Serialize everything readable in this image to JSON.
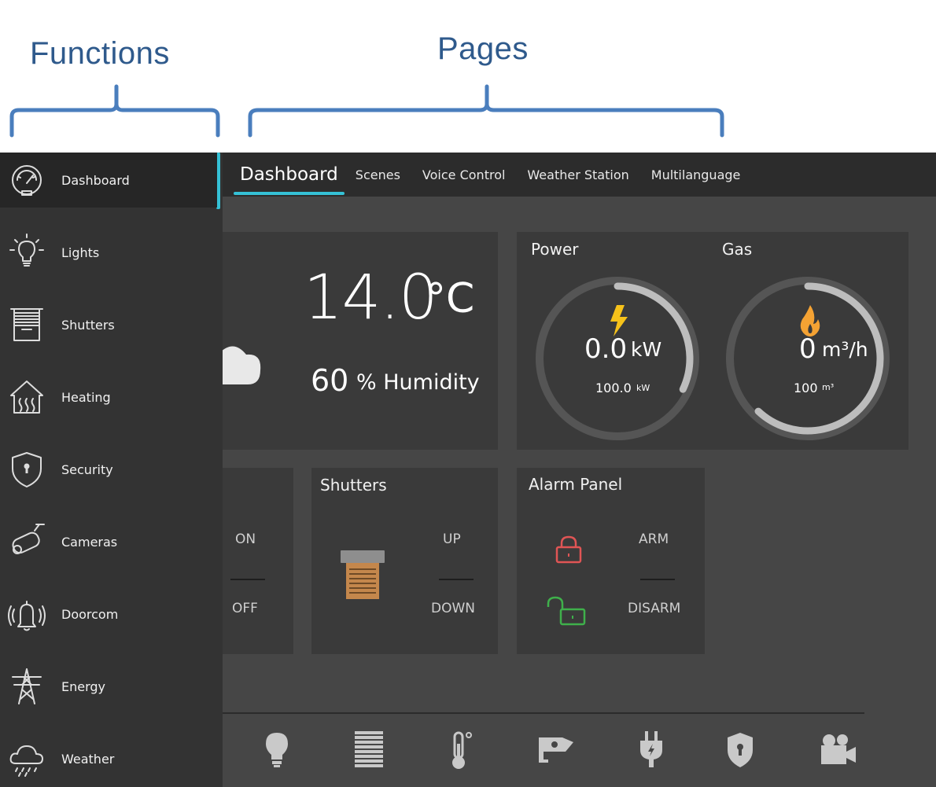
{
  "annotations": {
    "functions": "Functions",
    "pages": "Pages"
  },
  "tabs": [
    {
      "label": "Dashboard",
      "active": true
    },
    {
      "label": "Scenes"
    },
    {
      "label": "Voice Control"
    },
    {
      "label": "Weather Station"
    },
    {
      "label": "Multilanguage"
    }
  ],
  "sidebar": {
    "items": [
      {
        "label": "Dashboard",
        "icon": "gauge-icon",
        "active": true
      },
      {
        "label": "Lights",
        "icon": "bulb-icon"
      },
      {
        "label": "Shutters",
        "icon": "shutter-icon"
      },
      {
        "label": "Heating",
        "icon": "heating-icon"
      },
      {
        "label": "Security",
        "icon": "shield-icon"
      },
      {
        "label": "Cameras",
        "icon": "camera-icon"
      },
      {
        "label": "Doorcom",
        "icon": "bell-icon"
      },
      {
        "label": "Energy",
        "icon": "pylon-icon"
      },
      {
        "label": "Weather",
        "icon": "rain-cloud-icon"
      }
    ]
  },
  "weather": {
    "temperature": "14.0",
    "unit": "°C",
    "humidity": "60",
    "humidity_label": "% Humidity"
  },
  "energy": {
    "power": {
      "title": "Power",
      "value": "0.0",
      "unit": "kW",
      "max": "100.0",
      "max_unit": "kW",
      "fraction": 0.32
    },
    "gas": {
      "title": "Gas",
      "value": "0",
      "unit": "m³/h",
      "max": "100",
      "max_unit": "m³",
      "fraction": 0.62
    }
  },
  "lights_switch": {
    "on": "ON",
    "off": "OFF"
  },
  "shutters": {
    "title": "Shutters",
    "up": "UP",
    "down": "DOWN"
  },
  "alarm": {
    "title": "Alarm Panel",
    "arm": "ARM",
    "disarm": "DISARM"
  },
  "colors": {
    "accent": "#35c1d6",
    "bolt": "#f6c21a",
    "flame": "#f4a233",
    "arm": "#e05555",
    "disarm": "#3fb04b",
    "shutter": "#c4874c"
  },
  "bottom_nav": [
    "bulb-icon",
    "shutter-icon",
    "thermometer-icon",
    "camera-icon",
    "plug-icon",
    "shield-icon",
    "video-camera-icon"
  ]
}
